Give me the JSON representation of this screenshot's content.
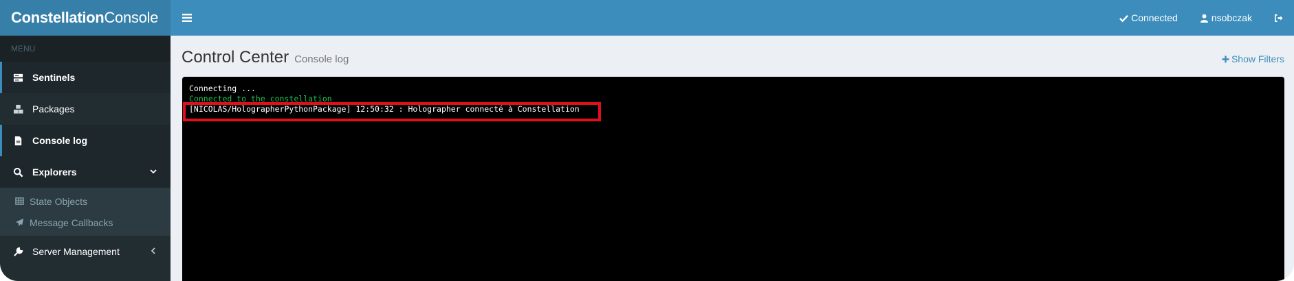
{
  "header": {
    "logo_bold": "Constellation",
    "logo_light": "Console",
    "status": "Connected",
    "user": "nsobczak"
  },
  "sidebar": {
    "menu_label": "MENU",
    "items": [
      {
        "label": "Sentinels",
        "icon": "server-icon"
      },
      {
        "label": "Packages",
        "icon": "cubes-icon"
      },
      {
        "label": "Console log",
        "icon": "file-icon"
      },
      {
        "label": "Explorers",
        "icon": "search-icon"
      },
      {
        "label": "Server Management",
        "icon": "wrench-icon"
      }
    ],
    "explorers_sub": [
      {
        "label": "State Objects",
        "icon": "table-icon"
      },
      {
        "label": "Message Callbacks",
        "icon": "paper-plane-icon"
      }
    ]
  },
  "main": {
    "title": "Control Center",
    "subtitle": "Console log",
    "filters_label": "Show Filters"
  },
  "console": {
    "lines": [
      "Connecting ...",
      "Connected to the constellation",
      "[NICOLAS/HolographerPythonPackage] 12:50:32 : Holographer connecté à Constellation"
    ]
  },
  "colors": {
    "header": "#3c8dbc",
    "logo_bg": "#367fa9",
    "sidebar": "#222d32",
    "highlight": "#e0101a",
    "console_green": "#20c050"
  }
}
